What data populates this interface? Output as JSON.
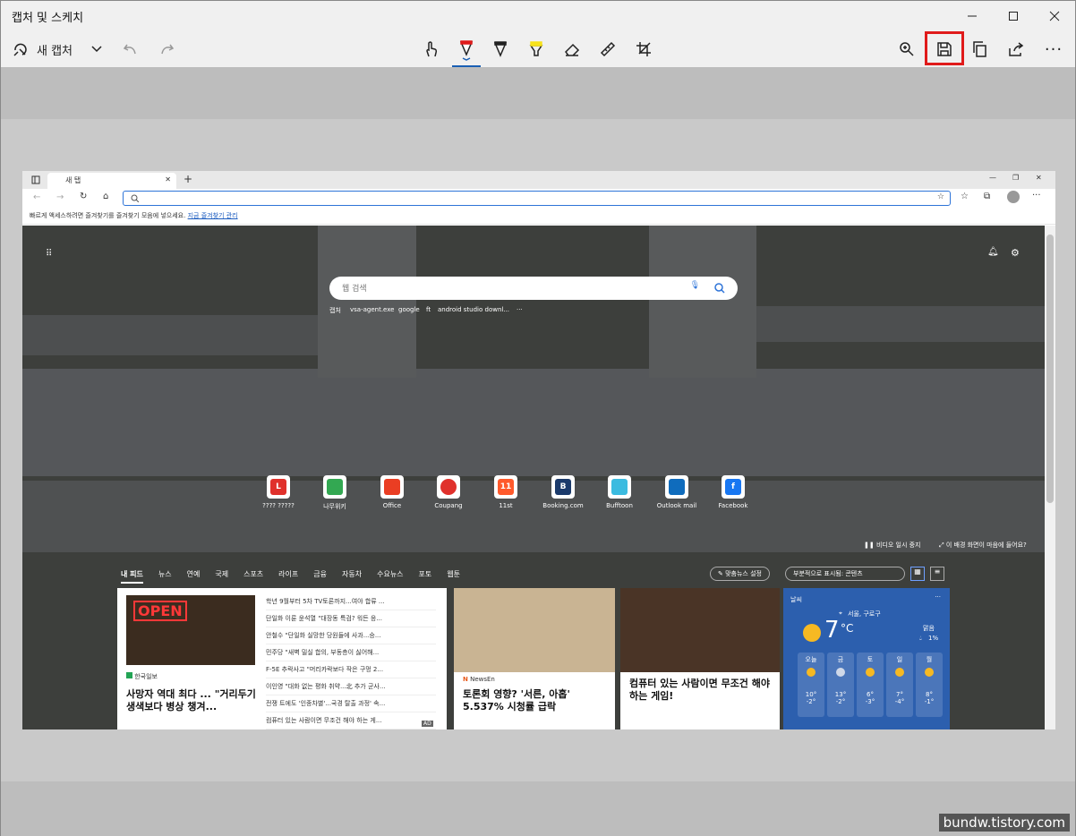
{
  "app": {
    "title": "캡처 및 스케치",
    "new_capture": "새 캡처"
  },
  "browser": {
    "tab_title": "새 탭",
    "fav_hint": "빠르게 액세스하려면 즐겨찾기를 즐겨찾기 모음에 넣으세요.",
    "fav_link": "지금 즐겨찾기 관리",
    "search_placeholder": "웹 검색",
    "quick_searches": [
      "캡처",
      "vsa-agent.exe",
      "google",
      "ft",
      "android studio downl...",
      "···"
    ],
    "tiles": [
      {
        "label": "???? ?????",
        "letter": "L",
        "color": "#e0312c"
      },
      {
        "label": "나무위키",
        "letter": "",
        "color": "#33a852"
      },
      {
        "label": "Office",
        "letter": "",
        "color": "#ea3e23"
      },
      {
        "label": "Coupang",
        "letter": "",
        "color": "#e0312c"
      },
      {
        "label": "11st",
        "letter": "11",
        "color": "#ff5a2c"
      },
      {
        "label": "Booking.com",
        "letter": "B",
        "color": "#1b3a6b"
      },
      {
        "label": "Bufftoon",
        "letter": "",
        "color": "#3bbbe0"
      },
      {
        "label": "Outlook mail",
        "letter": "",
        "color": "#0f6cbd"
      },
      {
        "label": "Facebook",
        "letter": "f",
        "color": "#1877f2"
      }
    ],
    "video_pause": "비디오 일시 중지",
    "bg_question": "이 배경 화면이 마음에 들어요?",
    "news_tabs": [
      "내 피드",
      "뉴스",
      "연예",
      "국제",
      "스포츠",
      "라이프",
      "금융",
      "자동차",
      "수요뉴스",
      "포토",
      "웹툰"
    ],
    "personalize": "맞춤뉴스 설정",
    "display_mode": "부분적으로 표시됨: 콘텐츠",
    "card1": {
      "source": "한국일보",
      "headline": "사망자 역대 최다 ... \"거리두기 생색보다 병상 챙겨...",
      "list": [
        "학년 9월부터 5차 TV토론까지...여야 합류 ...",
        "단일화 이룬 윤석열 \"대장동 특검? 워든 응...",
        "안철수 \"단일화 실망한 당원들에 사과...승...",
        "민주당 \"새벽 밀실 합의, 부동층이 싫어해...",
        "F-5E 추락사고 \"머리카락보다 작은 구멍 2...",
        "이인영 \"대화 없는 평화 취약...北 추가 군사...",
        "전쟁 트에도 '인종차별'...국경 탈출 과정' 속...",
        "컴퓨터 있는 사람이면 무조건 해야 하는 게..."
      ],
      "ad": "AD"
    },
    "card2": {
      "source": "NewsEn",
      "headline": "토론회 영향? '서른, 아홉' 5.537% 시청률 급락"
    },
    "card3": {
      "headline": "컴퓨터 있는 사람이면 무조건 해야 하는 게임!"
    },
    "weather": {
      "title": "날씨",
      "location": "서울, 구로구",
      "temp": "7",
      "unit": "°C",
      "desc": "맑음",
      "precip": "1%",
      "days": [
        {
          "day": "오늘",
          "hi": "10°",
          "lo": "-2°"
        },
        {
          "day": "금",
          "hi": "13°",
          "lo": "-2°"
        },
        {
          "day": "토",
          "hi": "6°",
          "lo": "-3°"
        },
        {
          "day": "일",
          "hi": "7°",
          "lo": "-4°"
        },
        {
          "day": "월",
          "hi": "8°",
          "lo": "-1°"
        }
      ]
    }
  },
  "watermark": "bundw.tistory.com",
  "highlight_color": "#e01b1b"
}
